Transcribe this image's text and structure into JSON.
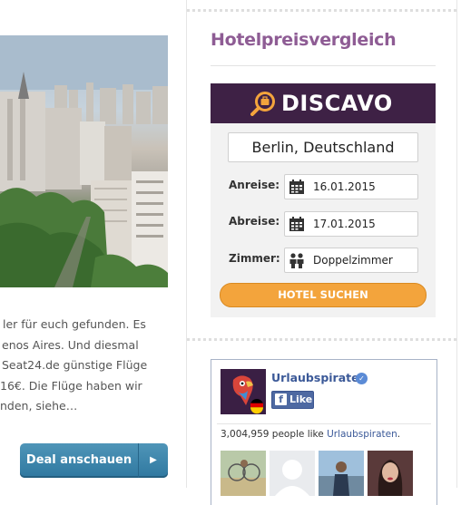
{
  "article": {
    "excerpt_lines": [
      "ler für euch gefunden. Es",
      "enos Aires. Und diesmal",
      " Seat24.de günstige Flüge",
      "16€. Die Flüge haben wir",
      "nden, siehe…"
    ],
    "deal_button": "Deal anschauen"
  },
  "sidebar": {
    "widget_title": "Hotelpreisvergleich",
    "discavo": {
      "brand": "DISCAVO",
      "city": "Berlin, Deutschland",
      "arrival_label": "Anreise:",
      "arrival_value": "16.01.2015",
      "departure_label": "Abreise:",
      "departure_value": "17.01.2015",
      "room_label": "Zimmer:",
      "room_value": "Doppelzimmer",
      "search_button": "HOTEL SUCHEN",
      "colors": {
        "header": "#3e2145",
        "button": "#f3a43c"
      }
    },
    "facebook": {
      "page_name": "Urlaubspiraten",
      "like_button": "Like",
      "likes_text": "3,004,959 people like",
      "likes_link": "Urlaubspiraten",
      "likes_suffix": "."
    }
  },
  "icons": [
    "calendar-icon",
    "people-icon",
    "magnifier-suitcase-icon",
    "verified-icon",
    "facebook-f-icon",
    "chevron-right-icon"
  ]
}
